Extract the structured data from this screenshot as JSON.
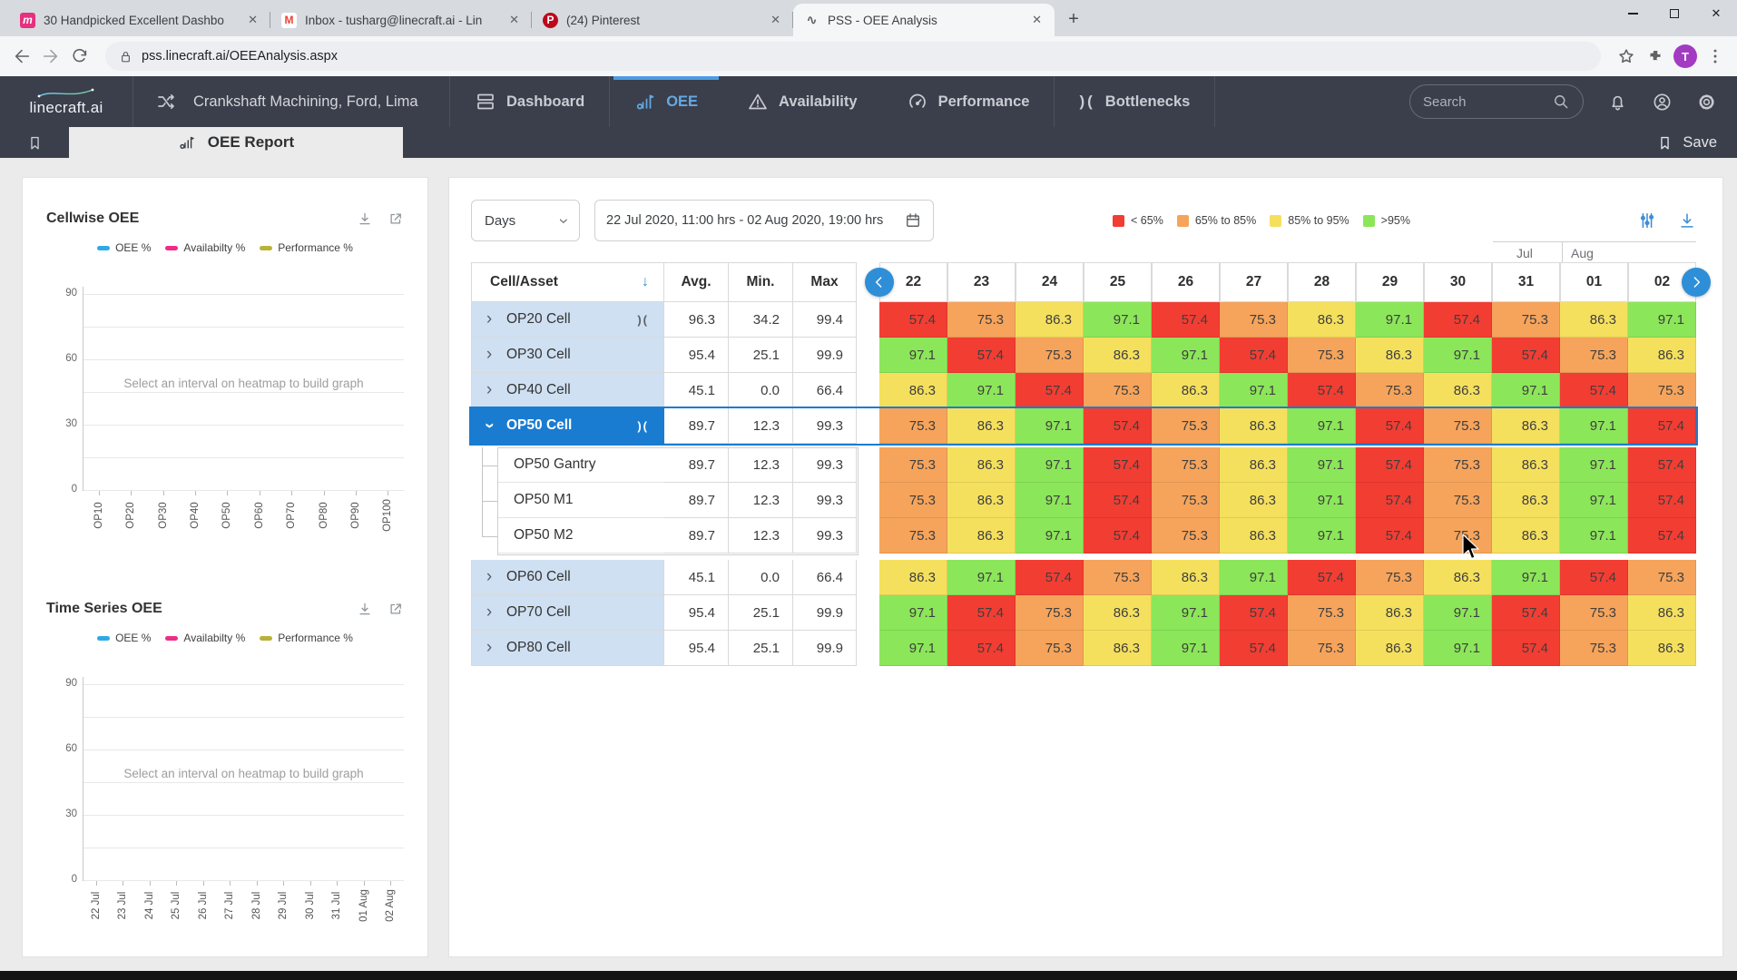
{
  "browser": {
    "tabs": [
      {
        "title": "30 Handpicked Excellent Dashbo",
        "favicon": "muzli",
        "active": false
      },
      {
        "title": "Inbox - tusharg@linecraft.ai - Lin",
        "favicon": "gmail",
        "active": false
      },
      {
        "title": "(24) Pinterest",
        "favicon": "pinterest",
        "active": false
      },
      {
        "title": "PSS - OEE Analysis",
        "favicon": "pss",
        "active": true
      }
    ],
    "url": "pss.linecraft.ai/OEEAnalysis.aspx",
    "avatar_initial": "T"
  },
  "nav": {
    "logo": "linecraft.ai",
    "context": "Crankshaft Machining, Ford, Lima",
    "items": [
      {
        "label": "Dashboard",
        "icon": "dashboard",
        "active": false
      },
      {
        "label": "OEE",
        "icon": "oee",
        "active": true
      },
      {
        "label": "Availability",
        "icon": "availability",
        "active": false
      },
      {
        "label": "Performance",
        "icon": "performance",
        "active": false
      },
      {
        "label": "Bottlenecks",
        "icon": "bottleneck",
        "active": false
      }
    ],
    "search_placeholder": "Search"
  },
  "report_bar": {
    "tab_label": "OEE Report",
    "save_label": "Save"
  },
  "charts": [
    {
      "title": "Cellwise OEE",
      "legend": [
        {
          "label": "OEE %",
          "color": "#2fa9e6"
        },
        {
          "label": "Availabilty %",
          "color": "#ee2d86"
        },
        {
          "label": "Performance %",
          "color": "#b9b239"
        }
      ],
      "y_ticks": [
        "90",
        "60",
        "30",
        "0"
      ],
      "placeholder": "Select an interval on heatmap to build graph",
      "x_labels": [
        "OP10",
        "OP20",
        "OP30",
        "OP40",
        "OP50",
        "OP60",
        "OP70",
        "OP80",
        "OP90",
        "OP100"
      ]
    },
    {
      "title": "Time Series OEE",
      "legend": [
        {
          "label": "OEE %",
          "color": "#2fa9e6"
        },
        {
          "label": "Availabilty %",
          "color": "#ee2d86"
        },
        {
          "label": "Performance %",
          "color": "#b9b239"
        }
      ],
      "y_ticks": [
        "90",
        "60",
        "30",
        "0"
      ],
      "placeholder": "Select an interval on heatmap to build graph",
      "x_labels": [
        "22 Jul",
        "23 Jul",
        "24 Jul",
        "25 Jul",
        "26 Jul",
        "27 Jul",
        "28 Jul",
        "29 Jul",
        "30 Jul",
        "31 Jul",
        "01 Aug",
        "02 Aug"
      ]
    }
  ],
  "toolbar": {
    "interval": "Days",
    "date_range": "22 Jul 2020, 11:00 hrs - 02 Aug 2020, 19:00 hrs"
  },
  "heatmap": {
    "legend": [
      {
        "label": "< 65%",
        "color": "#f23d33"
      },
      {
        "label": "65% to 85%",
        "color": "#f6a45b"
      },
      {
        "label": "85% to 95%",
        "color": "#f5e05e"
      },
      {
        "label": ">95%",
        "color": "#8ce65a"
      }
    ],
    "thresholds": [
      65,
      85,
      95
    ],
    "columns": {
      "name": "Cell/Asset",
      "avg": "Avg.",
      "min": "Min.",
      "max": "Max"
    },
    "months": [
      "Jul",
      "Aug"
    ],
    "dates": [
      "22",
      "23",
      "24",
      "25",
      "26",
      "27",
      "28",
      "29",
      "30",
      "31",
      "01",
      "02"
    ],
    "rows": [
      {
        "name": "OP20 Cell",
        "avg": "96.3",
        "min": "34.2",
        "max": "99.4",
        "level": "parent",
        "expanded": false,
        "selected": false,
        "bottleneck": true,
        "values": [
          57.4,
          75.3,
          86.3,
          97.1,
          57.4,
          75.3,
          86.3,
          97.1,
          57.4,
          75.3,
          86.3,
          97.1
        ]
      },
      {
        "name": "OP30 Cell",
        "avg": "95.4",
        "min": "25.1",
        "max": "99.9",
        "level": "parent",
        "expanded": false,
        "selected": false,
        "bottleneck": false,
        "values": [
          97.1,
          57.4,
          75.3,
          86.3,
          97.1,
          57.4,
          75.3,
          86.3,
          97.1,
          57.4,
          75.3,
          86.3
        ]
      },
      {
        "name": "OP40 Cell",
        "avg": "45.1",
        "min": "0.0",
        "max": "66.4",
        "level": "parent",
        "expanded": false,
        "selected": false,
        "bottleneck": false,
        "values": [
          86.3,
          97.1,
          57.4,
          75.3,
          86.3,
          97.1,
          57.4,
          75.3,
          86.3,
          97.1,
          57.4,
          75.3
        ]
      },
      {
        "name": "OP50 Cell",
        "avg": "89.7",
        "min": "12.3",
        "max": "99.3",
        "level": "parent",
        "expanded": true,
        "selected": true,
        "bottleneck": true,
        "values": [
          75.3,
          86.3,
          97.1,
          57.4,
          75.3,
          86.3,
          97.1,
          57.4,
          75.3,
          86.3,
          97.1,
          57.4
        ]
      },
      {
        "name": "OP50 Gantry",
        "avg": "89.7",
        "min": "12.3",
        "max": "99.3",
        "level": "child",
        "expanded": false,
        "selected": false,
        "bottleneck": false,
        "values": [
          75.3,
          86.3,
          97.1,
          57.4,
          75.3,
          86.3,
          97.1,
          57.4,
          75.3,
          86.3,
          97.1,
          57.4
        ]
      },
      {
        "name": "OP50 M1",
        "avg": "89.7",
        "min": "12.3",
        "max": "99.3",
        "level": "child",
        "expanded": false,
        "selected": false,
        "bottleneck": false,
        "values": [
          75.3,
          86.3,
          97.1,
          57.4,
          75.3,
          86.3,
          97.1,
          57.4,
          75.3,
          86.3,
          97.1,
          57.4
        ]
      },
      {
        "name": "OP50 M2",
        "avg": "89.7",
        "min": "12.3",
        "max": "99.3",
        "level": "child",
        "expanded": false,
        "selected": false,
        "bottleneck": false,
        "values": [
          75.3,
          86.3,
          97.1,
          57.4,
          75.3,
          86.3,
          97.1,
          57.4,
          75.3,
          86.3,
          97.1,
          57.4
        ]
      },
      {
        "name": "OP60 Cell",
        "avg": "45.1",
        "min": "0.0",
        "max": "66.4",
        "level": "parent",
        "expanded": false,
        "selected": false,
        "bottleneck": false,
        "values": [
          86.3,
          97.1,
          57.4,
          75.3,
          86.3,
          97.1,
          57.4,
          75.3,
          86.3,
          97.1,
          57.4,
          75.3
        ]
      },
      {
        "name": "OP70 Cell",
        "avg": "95.4",
        "min": "25.1",
        "max": "99.9",
        "level": "parent",
        "expanded": false,
        "selected": false,
        "bottleneck": false,
        "values": [
          97.1,
          57.4,
          75.3,
          86.3,
          97.1,
          57.4,
          75.3,
          86.3,
          97.1,
          57.4,
          75.3,
          86.3
        ]
      },
      {
        "name": "OP80 Cell",
        "avg": "95.4",
        "min": "25.1",
        "max": "99.9",
        "level": "parent",
        "expanded": false,
        "selected": false,
        "bottleneck": false,
        "values": [
          97.1,
          57.4,
          75.3,
          86.3,
          97.1,
          57.4,
          75.3,
          86.3,
          97.1,
          57.4,
          75.3,
          86.3
        ]
      }
    ]
  }
}
